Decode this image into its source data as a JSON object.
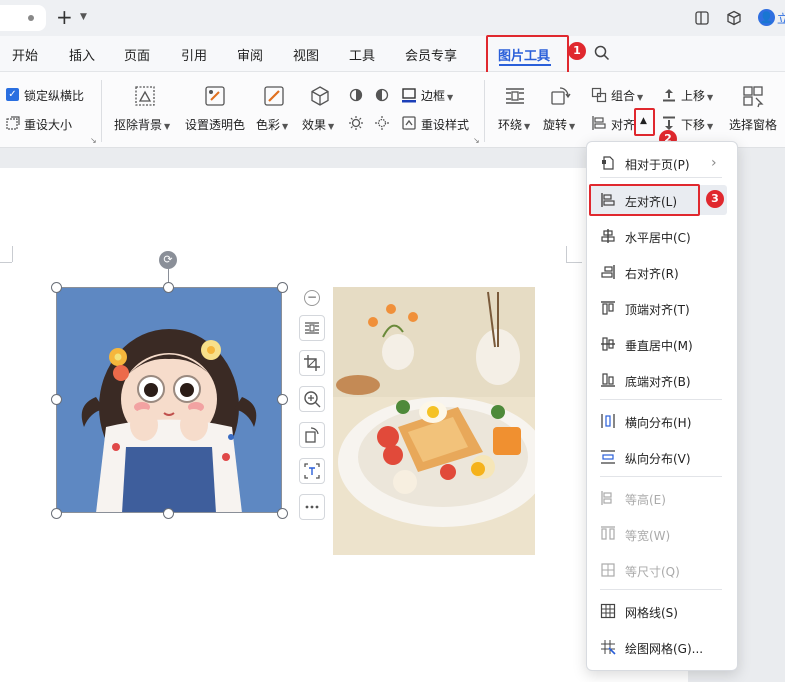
{
  "menu": {
    "tabs": [
      "开始",
      "插入",
      "页面",
      "引用",
      "审阅",
      "视图",
      "工具",
      "会员专享",
      "图片工具"
    ],
    "active_tab": "图片工具"
  },
  "titlebar": {
    "login_text": "立"
  },
  "ribbon": {
    "lock_ratio_label": "锁定纵横比",
    "reset_size_label": "重设大小",
    "remove_bg_label": "抠除背景",
    "set_transparent_label": "设置透明色",
    "color_label": "色彩",
    "effects_label": "效果",
    "border_label": "边框",
    "reset_style_label": "重设样式",
    "wrap_label": "环绕",
    "rotate_label": "旋转",
    "group_label": "组合",
    "align_label": "对齐",
    "bring_forward_label": "上移",
    "send_backward_label": "下移",
    "selection_pane_label": "选择窗格"
  },
  "annotations": {
    "badge1": "1",
    "badge2": "2",
    "badge3": "3"
  },
  "dropdown": {
    "items": [
      {
        "label": "相对于页(P)",
        "icon": "page-relative-icon",
        "disabled": false
      },
      {
        "label": "左对齐(L)",
        "icon": "align-left-icon",
        "disabled": false
      },
      {
        "label": "水平居中(C)",
        "icon": "align-center-h-icon",
        "disabled": false
      },
      {
        "label": "右对齐(R)",
        "icon": "align-right-icon",
        "disabled": false
      },
      {
        "label": "顶端对齐(T)",
        "icon": "align-top-icon",
        "disabled": false
      },
      {
        "label": "垂直居中(M)",
        "icon": "align-middle-v-icon",
        "disabled": false
      },
      {
        "label": "底端对齐(B)",
        "icon": "align-bottom-icon",
        "disabled": false
      },
      {
        "label": "横向分布(H)",
        "icon": "distribute-h-icon",
        "disabled": false
      },
      {
        "label": "纵向分布(V)",
        "icon": "distribute-v-icon",
        "disabled": false
      },
      {
        "label": "等高(E)",
        "icon": "same-height-icon",
        "disabled": true
      },
      {
        "label": "等宽(W)",
        "icon": "same-width-icon",
        "disabled": true
      },
      {
        "label": "等尺寸(Q)",
        "icon": "same-size-icon",
        "disabled": true
      },
      {
        "label": "网格线(S)",
        "icon": "gridlines-icon",
        "disabled": false
      },
      {
        "label": "绘图网格(G)...",
        "icon": "drawing-grid-icon",
        "disabled": false
      }
    ]
  },
  "colors": {
    "accent": "#2a5fd9",
    "annotation_red": "#e0282e"
  }
}
